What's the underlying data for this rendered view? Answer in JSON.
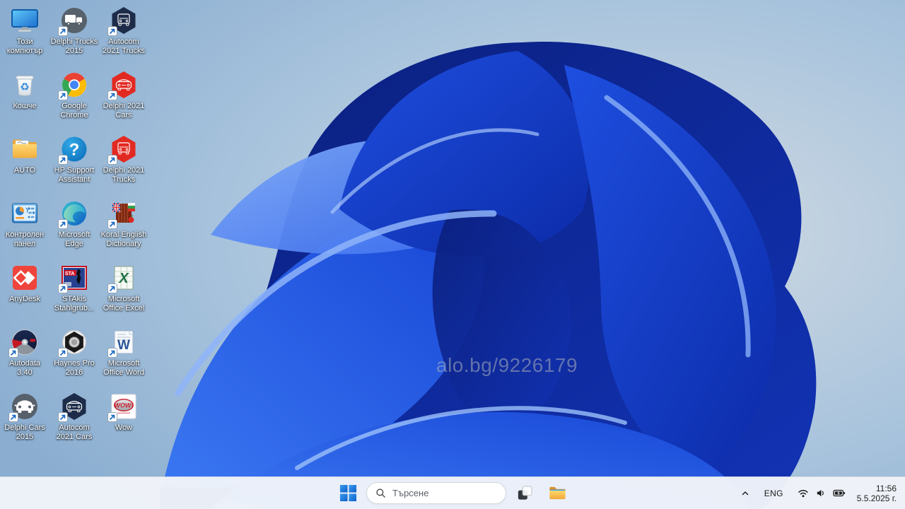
{
  "wallpaper": {
    "watermark": "alo.bg/9226179",
    "colors": {
      "sky_light": "#aac5dd",
      "sky_dark": "#8db0d2",
      "bloom_bright": "#2e63ec",
      "bloom_deep": "#0a1e7a",
      "bloom_highlight": "#8fb4f9"
    }
  },
  "desktop": {
    "icons": [
      {
        "id": "this-pc",
        "label": "Този\nкомпютър",
        "shortcut": false
      },
      {
        "id": "delphi-trucks-2015",
        "label": "Delphi Trucks\n2015",
        "shortcut": true
      },
      {
        "id": "autocom-2021-trucks",
        "label": "Autocom\n2021 Trucks",
        "shortcut": true
      },
      {
        "id": "recycle-bin",
        "label": "Кошче",
        "shortcut": false,
        "glyph": "♻"
      },
      {
        "id": "google-chrome",
        "label": "Google\nChrome",
        "shortcut": true
      },
      {
        "id": "delphi-2021-cars",
        "label": "Delphi 2021\nCars",
        "shortcut": true
      },
      {
        "id": "auto-folder",
        "label": "AUTO",
        "shortcut": false
      },
      {
        "id": "hp-support-assistant",
        "label": "HP Support\nAssistant",
        "shortcut": true,
        "glyph": "?"
      },
      {
        "id": "delphi-2021-trucks",
        "label": "Delphi 2021\nTrucks",
        "shortcut": true
      },
      {
        "id": "control-panel",
        "label": "Контролен\nпанел",
        "shortcut": false
      },
      {
        "id": "microsoft-edge",
        "label": "Microsoft\nEdge",
        "shortcut": true
      },
      {
        "id": "koral-english-dictionary",
        "label": "Koral English\nDictionary",
        "shortcut": true
      },
      {
        "id": "anydesk",
        "label": "AnyDesk",
        "shortcut": false
      },
      {
        "id": "stakis-stahlgruber",
        "label": "STAkis\nStahlgrub...",
        "shortcut": true,
        "glyph": "STA"
      },
      {
        "id": "microsoft-office-excel",
        "label": "Microsoft\nOffice Excel",
        "shortcut": true,
        "glyph": "X"
      },
      {
        "id": "autodata-3-40",
        "label": "Autodata\n3.40",
        "shortcut": true
      },
      {
        "id": "haynes-pro-2016",
        "label": "Haynes Pro\n2016",
        "shortcut": true
      },
      {
        "id": "microsoft-office-word",
        "label": "Microsoft\nOffice Word",
        "shortcut": true,
        "glyph": "W"
      },
      {
        "id": "delphi-cars-2015",
        "label": "Delphi Cars\n2015",
        "shortcut": true
      },
      {
        "id": "autocom-2021-cars",
        "label": "Autocom\n2021 Cars",
        "shortcut": true
      },
      {
        "id": "wow",
        "label": "Wow",
        "shortcut": true,
        "glyph": "WOW!"
      }
    ]
  },
  "taskbar": {
    "search_placeholder": "Търсене",
    "icons": [
      "start",
      "search",
      "task-view",
      "file-explorer",
      "tray-chevron",
      "wifi",
      "volume",
      "battery",
      "clock"
    ],
    "tray": {
      "language": "ENG",
      "time": "11:56",
      "date": "5.5.2025 г."
    },
    "colors": {
      "bar_bg": "#f1f4f9",
      "start_blue": "#1173d4"
    }
  }
}
